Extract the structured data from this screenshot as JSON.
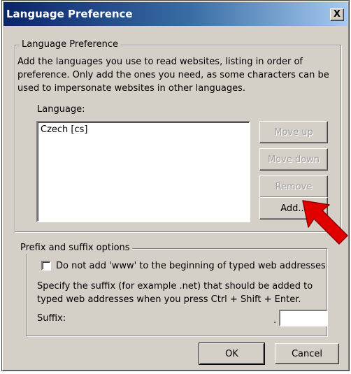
{
  "window": {
    "title": "Language Preference",
    "close_glyph": "X"
  },
  "language_group": {
    "legend": "Language Preference",
    "description": "Add the languages you use to read websites, listing in order of preference. Only add the ones you need, as some characters can be used to impersonate websites in other languages.",
    "list_label": "Language:",
    "languages": [
      "Czech [cs]"
    ],
    "buttons": {
      "move_up": "Move up",
      "move_down": "Move down",
      "remove": "Remove",
      "add": "Add..."
    }
  },
  "prefix_group": {
    "legend": "Prefix and suffix options",
    "checkbox_label": "Do not add 'www' to the beginning of typed web addresses",
    "checkbox_checked": false,
    "suffix_description": "Specify the suffix (for example .net) that should be added to typed web addresses when you press Ctrl + Shift + Enter.",
    "suffix_label": "Suffix:",
    "suffix_dot": ".",
    "suffix_value": ""
  },
  "footer": {
    "ok": "OK",
    "cancel": "Cancel"
  },
  "annotation": {
    "arrow_color": "#e00000",
    "points_to": "add-button"
  }
}
